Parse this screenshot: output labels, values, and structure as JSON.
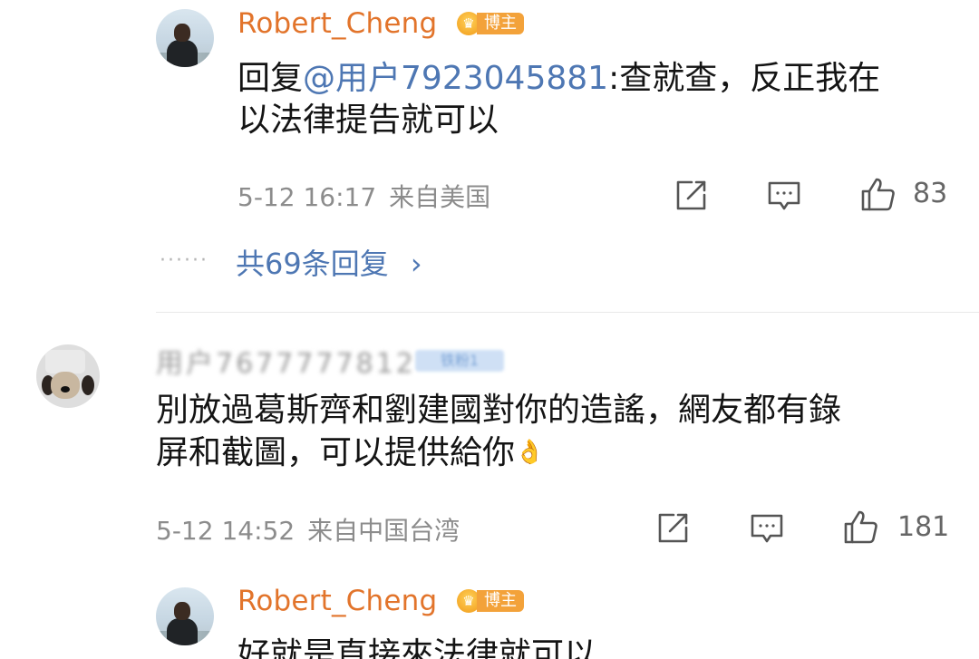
{
  "reply_top": {
    "username": "Robert_Cheng",
    "badge": "博主",
    "reply_prefix": "回复",
    "mention": "@用户7923045881",
    "text_after_mention": ":查就查，反正我在",
    "text_line2": "以法律提告就可以",
    "date": "5-12 16:17",
    "location": "来自美国",
    "likes": "83",
    "icons": [
      "share-icon",
      "comment-icon",
      "like-icon"
    ]
  },
  "replies_link": {
    "dots": "······",
    "label": "共69条回复",
    "arrow": "›"
  },
  "comment": {
    "username": "用户7677777812",
    "badge": "铁粉1",
    "text_line1": "別放過葛斯齊和劉建國對你的造謠，網友都有錄",
    "text_line2": "屏和截圖，可以提供給你",
    "emoji": "👌",
    "date": "5-12 14:52",
    "location": "来自中国台湾",
    "likes": "181"
  },
  "reply_bottom": {
    "username": "Robert_Cheng",
    "badge": "博主",
    "text_partial": "好就是直接來法律就可以"
  },
  "colors": {
    "username": "#e2742b",
    "mention": "#4e77b3",
    "meta": "#8c8c8c",
    "badge": "#f3a23a"
  }
}
